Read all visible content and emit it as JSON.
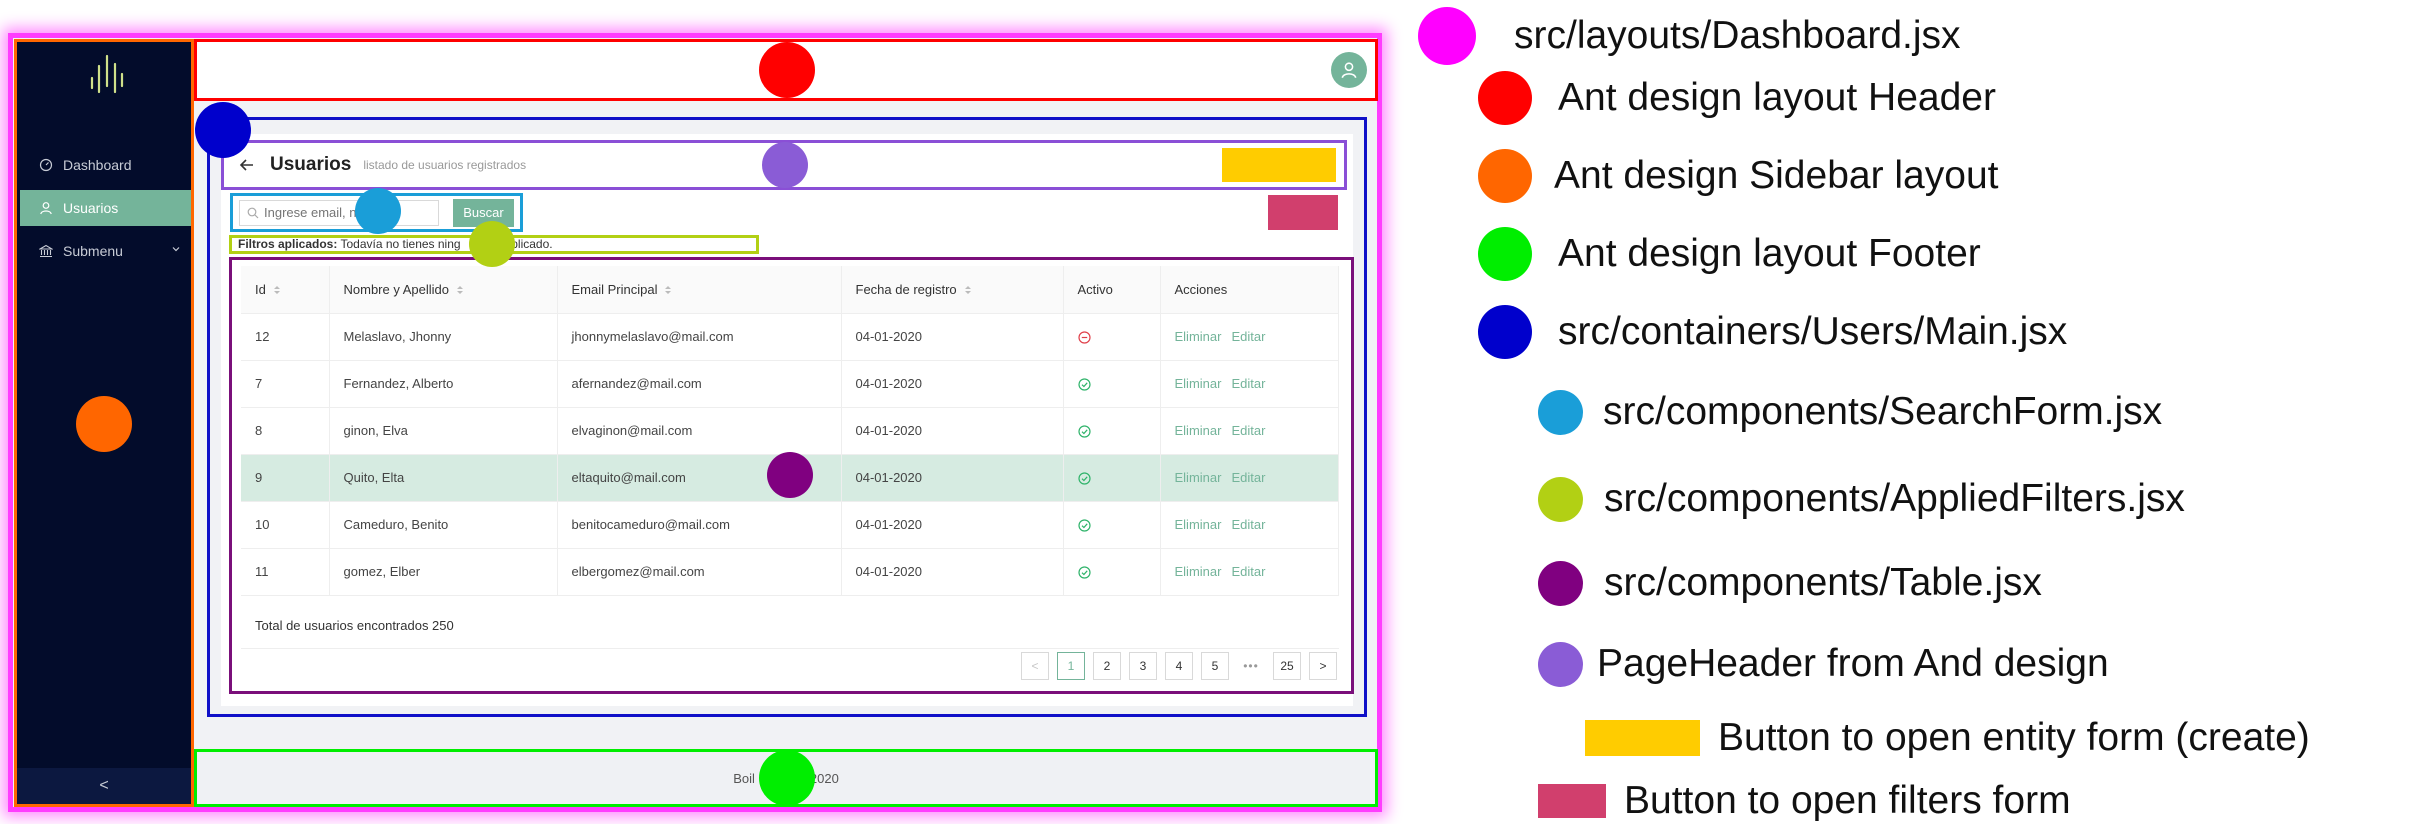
{
  "sidebar": {
    "items": [
      {
        "label": "Dashboard"
      },
      {
        "label": "Usuarios"
      },
      {
        "label": "Submenu"
      }
    ],
    "collapse_label": "<"
  },
  "page_header": {
    "title": "Usuarios",
    "subtitle": "listado de usuarios registrados"
  },
  "search": {
    "placeholder": "Ingrese email, n...",
    "button_label": "Buscar"
  },
  "applied_filters": {
    "label": "Filtros aplicados:",
    "text": "Todavía no tienes ning",
    "text_tail": "aplicado."
  },
  "table": {
    "columns": [
      "Id",
      "Nombre y Apellido",
      "Email Principal",
      "Fecha de registro",
      "Activo",
      "Acciones"
    ],
    "rows": [
      {
        "id": "12",
        "name": "Melaslavo, Jhonny",
        "email": "jhonnymelaslavo@mail.com",
        "date": "04-01-2020",
        "active": false
      },
      {
        "id": "7",
        "name": "Fernandez, Alberto",
        "email": "afernandez@mail.com",
        "date": "04-01-2020",
        "active": true
      },
      {
        "id": "8",
        "name": "ginon, Elva",
        "email": "elvaginon@mail.com",
        "date": "04-01-2020",
        "active": true
      },
      {
        "id": "9",
        "name": "Quito, Elta",
        "email": "eltaquito@mail.com",
        "date": "04-01-2020",
        "active": true
      },
      {
        "id": "10",
        "name": "Cameduro, Benito",
        "email": "benitocameduro@mail.com",
        "date": "04-01-2020",
        "active": true
      },
      {
        "id": "11",
        "name": "gomez, Elber",
        "email": "elbergomez@mail.com",
        "date": "04-01-2020",
        "active": true
      }
    ],
    "action_delete": "Eliminar",
    "action_edit": "Editar",
    "total_text": "Total de usuarios encontrados 250"
  },
  "pagination": {
    "prev": "<",
    "next": ">",
    "pages": [
      "1",
      "2",
      "3",
      "4",
      "5",
      "•••",
      "25"
    ],
    "current": "1"
  },
  "footer": {
    "text_left": "Boil",
    "text_right": "2020"
  },
  "legend": {
    "items": [
      {
        "label": "src/layouts/Dashboard.jsx",
        "color": "#ff00ff"
      },
      {
        "label": "Ant design layout Header",
        "color": "#ff0000"
      },
      {
        "label": "Ant design Sidebar layout",
        "color": "#ff6600"
      },
      {
        "label": "Ant design layout Footer",
        "color": "#00ee00"
      },
      {
        "label": "src/containers/Users/Main.jsx",
        "color": "#0000cc"
      },
      {
        "label": "src/components/SearchForm.jsx",
        "color": "#1a9ed8"
      },
      {
        "label": "src/components/AppliedFilters.jsx",
        "color": "#b2d014"
      },
      {
        "label": "src/components/Table.jsx",
        "color": "#800080"
      },
      {
        "label": "PageHeader from And design",
        "color": "#8a5cd6"
      },
      {
        "label": "Button to open entity form (create)",
        "color": "#ffcc00"
      },
      {
        "label": "Button to open filters form",
        "color": "#d13f6d"
      }
    ]
  }
}
